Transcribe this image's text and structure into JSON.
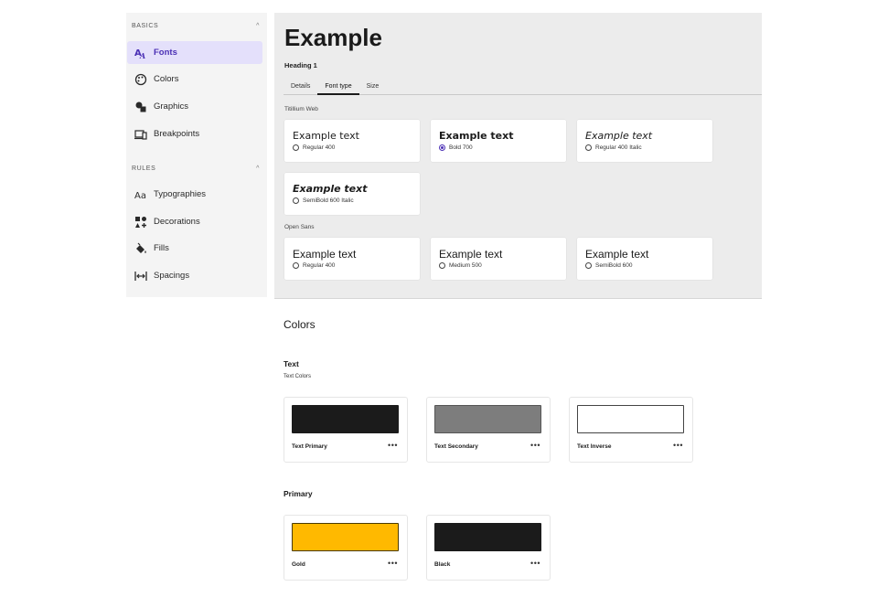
{
  "sidebar": {
    "basics_label": "BASICS",
    "rules_label": "RULES",
    "collapse_glyph": "^",
    "basics_items": [
      {
        "label": "Fonts",
        "icon": "fonts-icon",
        "active": true
      },
      {
        "label": "Colors",
        "icon": "palette-icon",
        "active": false
      },
      {
        "label": "Graphics",
        "icon": "shapes-icon",
        "active": false
      },
      {
        "label": "Breakpoints",
        "icon": "devices-icon",
        "active": false
      }
    ],
    "rules_items": [
      {
        "label": "Typographies",
        "icon": "typography-icon"
      },
      {
        "label": "Decorations",
        "icon": "decorations-icon"
      },
      {
        "label": "Fills",
        "icon": "fill-bucket-icon"
      },
      {
        "label": "Spacings",
        "icon": "spacing-icon"
      }
    ]
  },
  "preview": {
    "title": "Example",
    "subtitle": "Heading 1",
    "tabs": [
      "Details",
      "Font type",
      "Size"
    ],
    "active_tab": "Font type",
    "font_groups": [
      {
        "name": "Titillium Web",
        "cards": [
          {
            "sample": "Example text",
            "option": "Regular 400",
            "checked": false
          },
          {
            "sample": "Example text",
            "option": "Bold 700",
            "checked": true
          },
          {
            "sample": "Example text",
            "option": "Regular 400 Italic",
            "checked": false
          },
          {
            "sample": "Example text",
            "option": "SemiBold 600 Italic",
            "checked": false
          }
        ]
      },
      {
        "name": "Open Sans",
        "cards": [
          {
            "sample": "Example text",
            "option": "Regular 400",
            "checked": false
          },
          {
            "sample": "Example text",
            "option": "Medium 500",
            "checked": false
          },
          {
            "sample": "Example text",
            "option": "SemiBold 600",
            "checked": false
          }
        ]
      }
    ]
  },
  "colors": {
    "title": "Colors",
    "text_group": {
      "title": "Text",
      "subtitle": "Text Colors",
      "swatches": [
        {
          "name": "Text Primary",
          "color": "#1b1b1b"
        },
        {
          "name": "Text Secondary",
          "color": "#7d7d7d"
        },
        {
          "name": "Text Inverse",
          "color": "#ffffff"
        }
      ]
    },
    "primary_group": {
      "title": "Primary",
      "swatches": [
        {
          "name": "Gold",
          "color": "#ffb900"
        },
        {
          "name": "Black",
          "color": "#1b1b1b"
        }
      ]
    },
    "more_glyph": "•••"
  },
  "accent_color": "#4b30b5"
}
